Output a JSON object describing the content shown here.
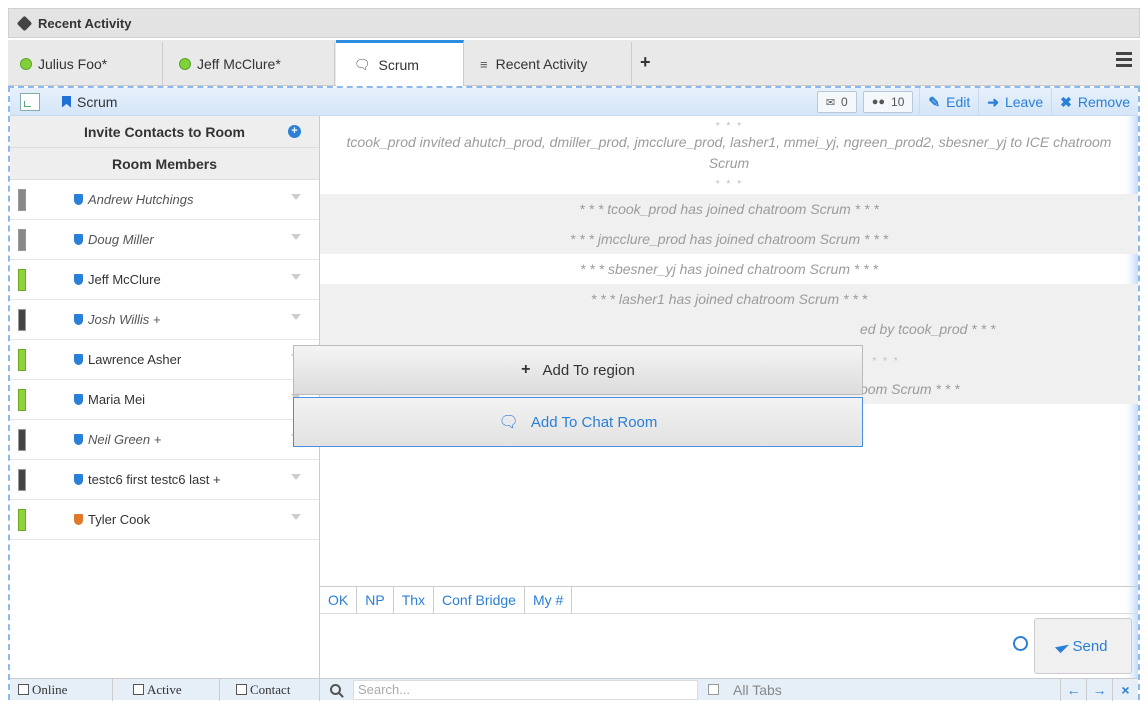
{
  "titlebar": {
    "title": "Recent Activity"
  },
  "tabs": [
    {
      "label": "Julius Foo*",
      "icon": "status-dot"
    },
    {
      "label": "Jeff McClure*",
      "icon": "status-dot"
    },
    {
      "label": "Scrum",
      "icon": "chat-icon"
    },
    {
      "label": "Recent Activity",
      "icon": "list-icon"
    }
  ],
  "tab_plus": "+",
  "room": {
    "name": "Scrum",
    "messages_count": "0",
    "members_count": "10",
    "edit": "Edit",
    "leave": "Leave",
    "remove": "Remove"
  },
  "sidebar": {
    "invite": "Invite Contacts to Room",
    "members_title": "Room Members",
    "members": [
      {
        "name": "Andrew Hutchings",
        "italic": true,
        "status": "gray",
        "role": "blue"
      },
      {
        "name": "Doug Miller",
        "italic": true,
        "status": "gray",
        "role": "blue"
      },
      {
        "name": "Jeff McClure",
        "italic": false,
        "status": "on",
        "role": "blue"
      },
      {
        "name": "Josh Willis +",
        "italic": true,
        "status": "dark",
        "role": "blue"
      },
      {
        "name": "Lawrence Asher",
        "italic": false,
        "status": "on",
        "role": "blue"
      },
      {
        "name": "Maria Mei",
        "italic": false,
        "status": "on",
        "role": "blue"
      },
      {
        "name": "Neil Green +",
        "italic": true,
        "status": "dark",
        "role": "blue"
      },
      {
        "name": "testc6 first testc6 last +",
        "italic": false,
        "status": "dark",
        "role": "blue"
      },
      {
        "name": "Tyler Cook",
        "italic": false,
        "status": "on",
        "role": "orange"
      }
    ]
  },
  "chat": {
    "stars": "* * *",
    "invite_msg": "tcook_prod invited ahutch_prod, dmiller_prod, jmcclure_prod, lasher1, mmei_yj, ngreen_prod2, sbesner_yj to ICE chatroom Scrum",
    "joins": [
      "* * *  tcook_prod has joined chatroom Scrum  * * *",
      "* * *  jmcclure_prod has joined chatroom Scrum  * * *",
      "* * *  sbesner_yj has joined chatroom Scrum  * * *",
      "* * *  lasher1 has joined chatroom Scrum  * * *",
      "ed by tcook_prod  * * *",
      "* * *",
      "oom Scrum  * * *"
    ]
  },
  "quick_buttons": [
    "OK",
    "NP",
    "Thx",
    "Conf Bridge",
    "My #"
  ],
  "send_label": "Send",
  "footer": {
    "online": "Online",
    "active": "Active",
    "contact": "Contact",
    "search_placeholder": "Search...",
    "all_tabs": "All Tabs",
    "back": "←",
    "forward": "→",
    "close": "×"
  },
  "popup": {
    "add_region": "Add To region",
    "add_chat": "Add To Chat Room"
  }
}
